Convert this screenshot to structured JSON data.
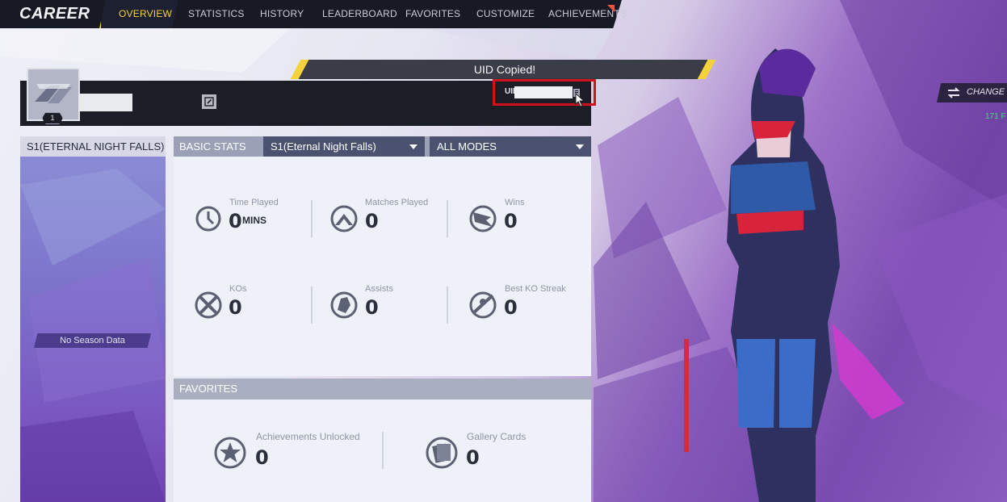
{
  "nav": {
    "title": "CAREER",
    "tabs": [
      "OVERVIEW",
      "STATISTICS",
      "HISTORY",
      "LEADERBOARD",
      "FAVORITES",
      "CUSTOMIZE",
      "ACHIEVEMENTS"
    ],
    "active_tab": "OVERVIEW",
    "accent_color": "#f4d23a"
  },
  "toast": {
    "text": "UID Copied!"
  },
  "profile": {
    "level": "1",
    "uid_label": "UID",
    "edit_icon": "edit-icon",
    "copy_icon": "copy-icon"
  },
  "season_panel": {
    "title": "S1(ETERNAL NIGHT FALLS)",
    "empty_text": "No Season Data"
  },
  "basic_stats": {
    "title": "BASIC STATS",
    "season_select": "S1(Eternal Night Falls)",
    "mode_select": "ALL MODES",
    "stats": [
      {
        "label": "Time Played",
        "value": "0",
        "unit": "MINS",
        "icon": "clock-icon"
      },
      {
        "label": "Matches Played",
        "value": "0",
        "icon": "crossed-swords-icon"
      },
      {
        "label": "Wins",
        "value": "0",
        "icon": "flag-icon"
      },
      {
        "label": "KOs",
        "value": "0",
        "icon": "crossed-blades-icon"
      },
      {
        "label": "Assists",
        "value": "0",
        "icon": "fist-icon"
      },
      {
        "label": "Best KO Streak",
        "value": "0",
        "icon": "streak-icon"
      }
    ]
  },
  "favorites": {
    "title": "FAVORITES",
    "items": [
      {
        "label": "Achievements Unlocked",
        "value": "0",
        "icon": "star-badge-icon"
      },
      {
        "label": "Gallery Cards",
        "value": "0",
        "icon": "cards-icon"
      }
    ]
  },
  "hero": {
    "change_label": "CHANGE HE",
    "count_text": "171 F"
  }
}
